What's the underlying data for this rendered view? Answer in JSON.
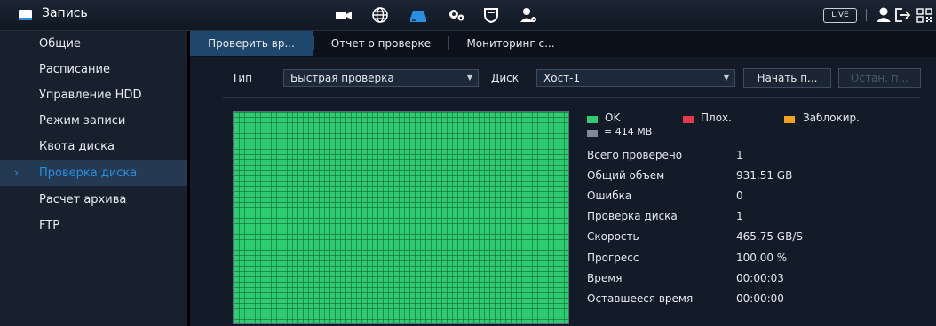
{
  "app": {
    "title": "Запись",
    "live_label": "LIVE"
  },
  "top_icons": [
    "camera-icon",
    "network-icon",
    "storage-icon",
    "settings-icon",
    "shield-icon",
    "account-icon",
    "user-icon",
    "logout-icon",
    "qr-icon"
  ],
  "sidebar": {
    "items": [
      {
        "label": "Общие"
      },
      {
        "label": "Расписание"
      },
      {
        "label": "Управление HDD"
      },
      {
        "label": "Режим записи"
      },
      {
        "label": "Квота диска"
      },
      {
        "label": "Проверка диска",
        "active": true
      },
      {
        "label": "Расчет архива"
      },
      {
        "label": "FTP"
      }
    ],
    "active_arrow": "›"
  },
  "tabs": [
    {
      "label": "Проверить вр...",
      "active": true
    },
    {
      "label": "Отчет о проверке"
    },
    {
      "label": "Мониторинг с..."
    }
  ],
  "controls": {
    "type_label": "Тип",
    "type_value": "Быстрая проверка",
    "disk_label": "Диск",
    "disk_value": "Хост-1",
    "start_button": "Начать п...",
    "stop_button": "Остан. п..."
  },
  "legend": {
    "ok": "OK",
    "bad": "Плох.",
    "blocked": "Заблокир.",
    "unit": "= 414 MB"
  },
  "colors": {
    "ok": "#2ecc71",
    "bad": "#e8394b",
    "blocked": "#f5a01a",
    "unit": "#7f8a99",
    "accent": "#2a8fe0"
  },
  "stats": [
    {
      "label": "Всего проверено",
      "value": "1"
    },
    {
      "label": "Общий объем",
      "value": "931.51 GB"
    },
    {
      "label": "Ошибка",
      "value": "0"
    },
    {
      "label": "Проверка диска",
      "value": "1"
    },
    {
      "label": "Скорость",
      "value": "465.75 GB/S"
    },
    {
      "label": "Прогресс",
      "value": "100.00 %"
    },
    {
      "label": "Время",
      "value": "00:00:03"
    },
    {
      "label": "Оставшеeся время",
      "value": "00:00:00"
    }
  ]
}
